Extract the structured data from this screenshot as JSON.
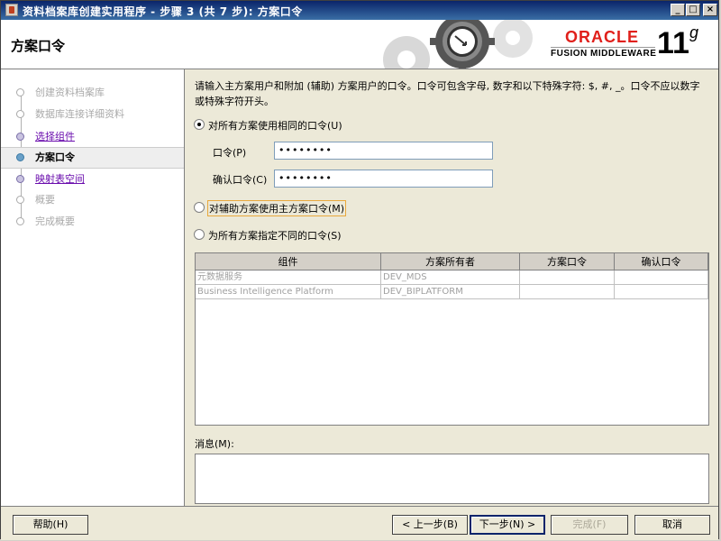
{
  "window": {
    "title": "资料档案库创建实用程序 - 步骤 3 (共 7 步): 方案口令",
    "min_glyph": "_",
    "max_glyph": "□",
    "close_glyph": "×"
  },
  "header": {
    "page_title": "方案口令",
    "brand": "ORACLE",
    "product": "FUSION MIDDLEWARE",
    "version": "11",
    "version_suffix": "g"
  },
  "sidebar": {
    "items": [
      {
        "label": "创建资料档案库",
        "state": "pending"
      },
      {
        "label": "数据库连接详细资料",
        "state": "pending"
      },
      {
        "label": "选择组件",
        "state": "done"
      },
      {
        "label": "方案口令",
        "state": "active"
      },
      {
        "label": "映射表空间",
        "state": "done"
      },
      {
        "label": "概要",
        "state": "pending"
      },
      {
        "label": "完成概要",
        "state": "pending"
      }
    ]
  },
  "main": {
    "instructions": "请输入主方案用户和附加 (辅助) 方案用户的口令。口令可包含字母, 数字和以下特殊字符: $, #, _。口令不应以数字或特殊字符开头。",
    "options": [
      {
        "label": "对所有方案使用相同的口令(U)",
        "checked": true
      },
      {
        "label": "对辅助方案使用主方案口令(M)",
        "checked": false
      },
      {
        "label": "为所有方案指定不同的口令(S)",
        "checked": false
      }
    ],
    "password_label": "口令(P)",
    "password_value": "••••••••",
    "confirm_label": "确认口令(C)",
    "confirm_value": "••••••••",
    "table": {
      "columns": [
        "组件",
        "方案所有者",
        "方案口令",
        "确认口令"
      ],
      "rows": [
        [
          "元数据服务",
          "DEV_MDS",
          "",
          ""
        ],
        [
          "Business Intelligence Platform",
          "DEV_BIPLATFORM",
          "",
          ""
        ]
      ]
    },
    "message_label": "消息(M):",
    "message_text": ""
  },
  "footer": {
    "help": "帮助(H)",
    "back": "< 上一步(B)",
    "next": "下一步(N) >",
    "finish": "完成(F)",
    "cancel": "取消"
  },
  "colors": {
    "oracle_red": "#e0201b",
    "title_bar": "#0a246a",
    "focus_border": "#e8a83c"
  }
}
